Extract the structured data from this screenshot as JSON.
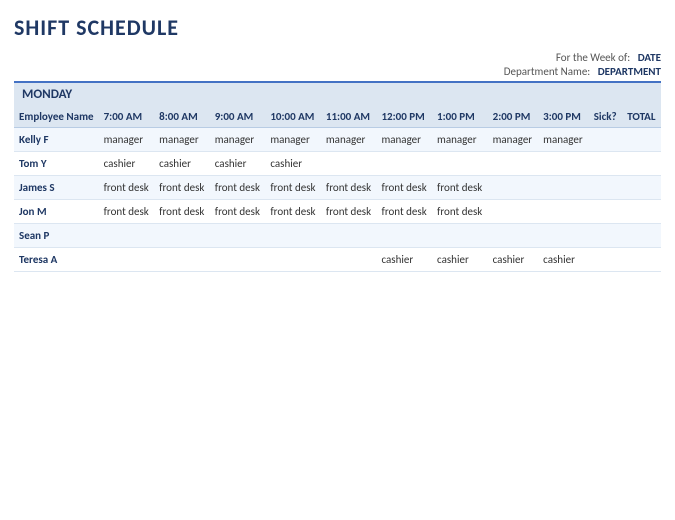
{
  "title": "SHIFT SCHEDULE",
  "header": {
    "week_label": "For the Week of:",
    "week_value": "DATE",
    "dept_label": "Department Name:",
    "dept_value": "DEPARTMENT"
  },
  "day": "MONDAY",
  "columns": [
    "Employee Name",
    "7:00 AM",
    "8:00 AM",
    "9:00 AM",
    "10:00 AM",
    "11:00 AM",
    "12:00 PM",
    "1:00 PM",
    "2:00 PM",
    "3:00 PM",
    "Sick?",
    "TOTAL"
  ],
  "rows": [
    {
      "name": "Kelly F",
      "shifts": [
        "manager",
        "manager",
        "manager",
        "manager",
        "manager",
        "manager",
        "manager",
        "manager",
        "manager",
        "",
        ""
      ]
    },
    {
      "name": "Tom Y",
      "shifts": [
        "cashier",
        "cashier",
        "cashier",
        "cashier",
        "",
        "",
        "",
        "",
        "",
        "",
        ""
      ]
    },
    {
      "name": "James S",
      "shifts": [
        "front desk",
        "front desk",
        "front desk",
        "front desk",
        "front desk",
        "front desk",
        "front desk",
        "",
        "",
        "",
        ""
      ]
    },
    {
      "name": "Jon M",
      "shifts": [
        "front desk",
        "front desk",
        "front desk",
        "front desk",
        "front desk",
        "front desk",
        "front desk",
        "",
        "",
        "",
        ""
      ]
    },
    {
      "name": "Sean P",
      "shifts": [
        "",
        "",
        "",
        "",
        "",
        "",
        "",
        "",
        "",
        "",
        ""
      ]
    },
    {
      "name": "Teresa A",
      "shifts": [
        "",
        "",
        "",
        "",
        "",
        "cashier",
        "cashier",
        "cashier",
        "cashier",
        "",
        ""
      ]
    }
  ]
}
